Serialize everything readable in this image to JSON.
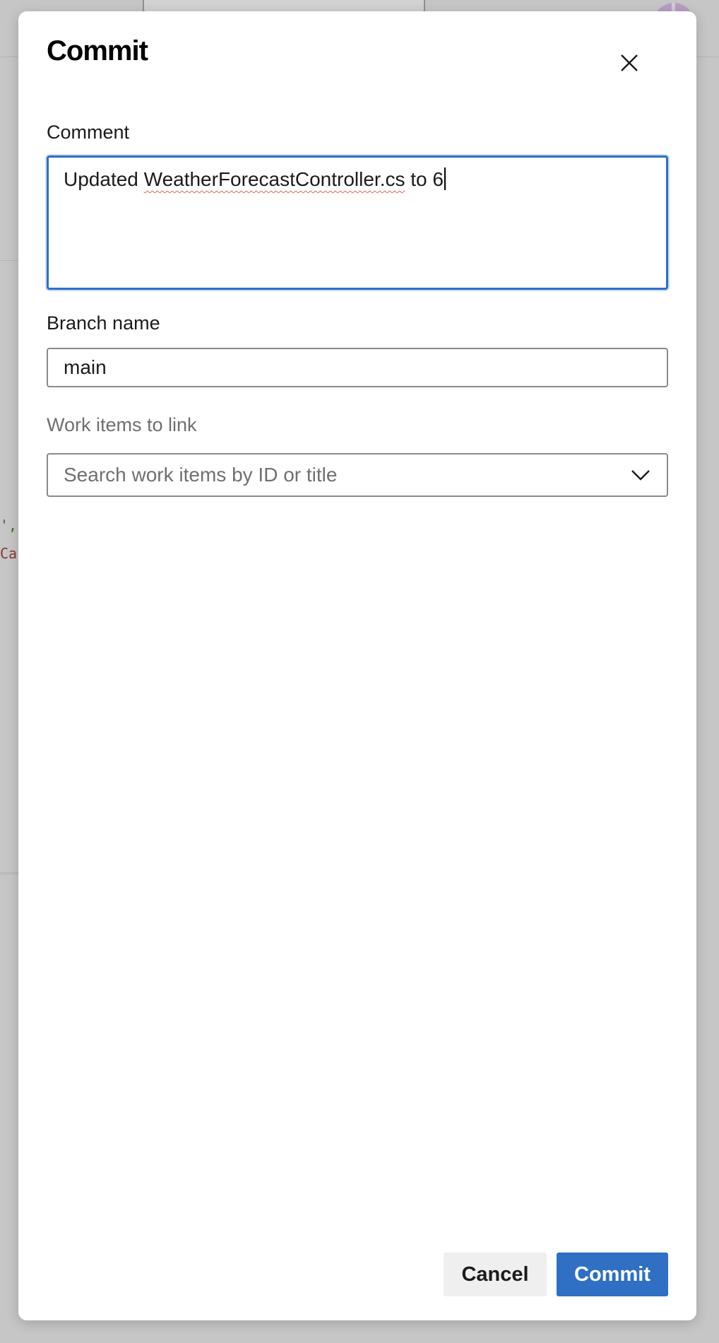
{
  "background": {
    "code_line_1": "',",
    "code_line_2": "Ca"
  },
  "dialog": {
    "title": "Commit",
    "close_icon": "close-icon",
    "comment": {
      "label": "Comment",
      "value_prefix": "Updated ",
      "value_misspelled": "WeatherForecastController.cs",
      "value_suffix": " to 6"
    },
    "branch": {
      "label": "Branch name",
      "value": "main"
    },
    "work_items": {
      "label": "Work items to link",
      "placeholder": "Search work items by ID or title",
      "icon": "chevron-down-icon"
    },
    "buttons": {
      "cancel": "Cancel",
      "commit": "Commit"
    }
  },
  "colors": {
    "primary": "#2f6fc4",
    "overlay": "#c6c6c6",
    "spellcheck": "#e06060"
  }
}
